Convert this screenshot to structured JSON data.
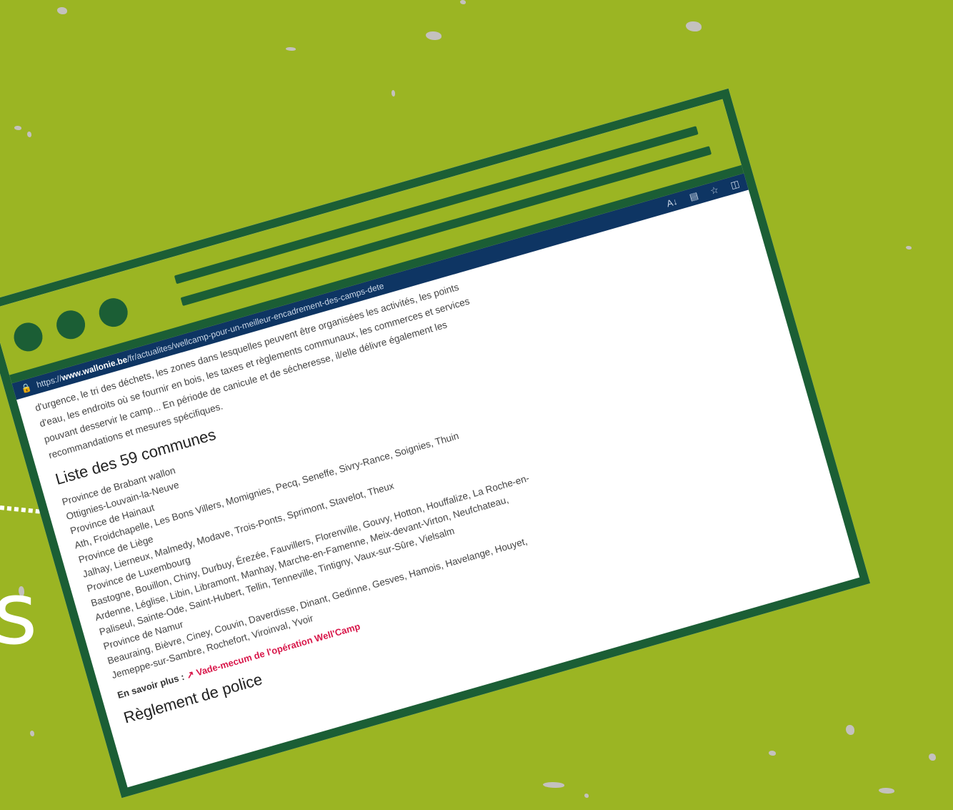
{
  "browser": {
    "url_prefix": "https://",
    "url_host": "www.wallonie.be",
    "url_path": "/fr/actualites/wellcamp-pour-un-meilleur-encadrement-des-camps-dete",
    "toolbar_icons": [
      "read-aloud-icon",
      "reader-view-icon",
      "favorite-star-icon",
      "sidebar-icon"
    ]
  },
  "article": {
    "intro_lines": [
      "d'urgence, le tri des déchets, les zones dans lesquelles peuvent être organisées les activités, les points",
      "d'eau, les endroits où se fournir en bois, les taxes et règlements communaux, les commerces et services",
      "pouvant desservir le camp... En période de canicule et de sécheresse, il/elle délivre également les",
      "recommandations et mesures spécifiques."
    ],
    "heading": "Liste des 59 communes",
    "lines": [
      "Province de Brabant wallon",
      "Ottignies-Louvain-la-Neuve",
      "Province de Hainaut",
      "Ath, Froidchapelle, Les Bons Villers, Momignies, Pecq, Seneffe, Sivry-Rance, Soignies, Thuin",
      "Province de Liège",
      "Jalhay, Lierneux, Malmedy, Modave, Trois-Ponts, Sprimont, Stavelot, Theux",
      "Province de Luxembourg",
      "Bastogne, Bouillon, Chiny, Durbuy, Érezée, Fauvillers, Florenville, Gouvy, Hotton, Houffalize, La Roche-en-",
      "Ardenne, Léglise, Libin, Libramont, Manhay, Marche-en-Famenne, Meix-devant-Virton, Neufchateau,",
      "Paliseul, Sainte-Ode, Saint-Hubert, Tellin, Tenneville, Tintigny, Vaux-sur-Sûre, Vielsalm",
      "Province de Namur",
      "Beauraing, Bièvre, Ciney, Couvin, Daverdisse, Dinant, Gedinne, Gesves, Hamois, Havelange, Houyet,",
      "Jemeppe-sur-Sambre, Rochefort, Viroinval, Yvoir"
    ],
    "more_label": "En savoir plus :",
    "more_link": "Vade-mecum de l'opération Well'Camp",
    "heading2": "Règlement de police"
  },
  "decor": {
    "side_letter": "s",
    "colors": {
      "background": "#9bb523",
      "frame": "#1b5e35",
      "url_bar": "#0e3563",
      "link": "#d8174a"
    }
  }
}
